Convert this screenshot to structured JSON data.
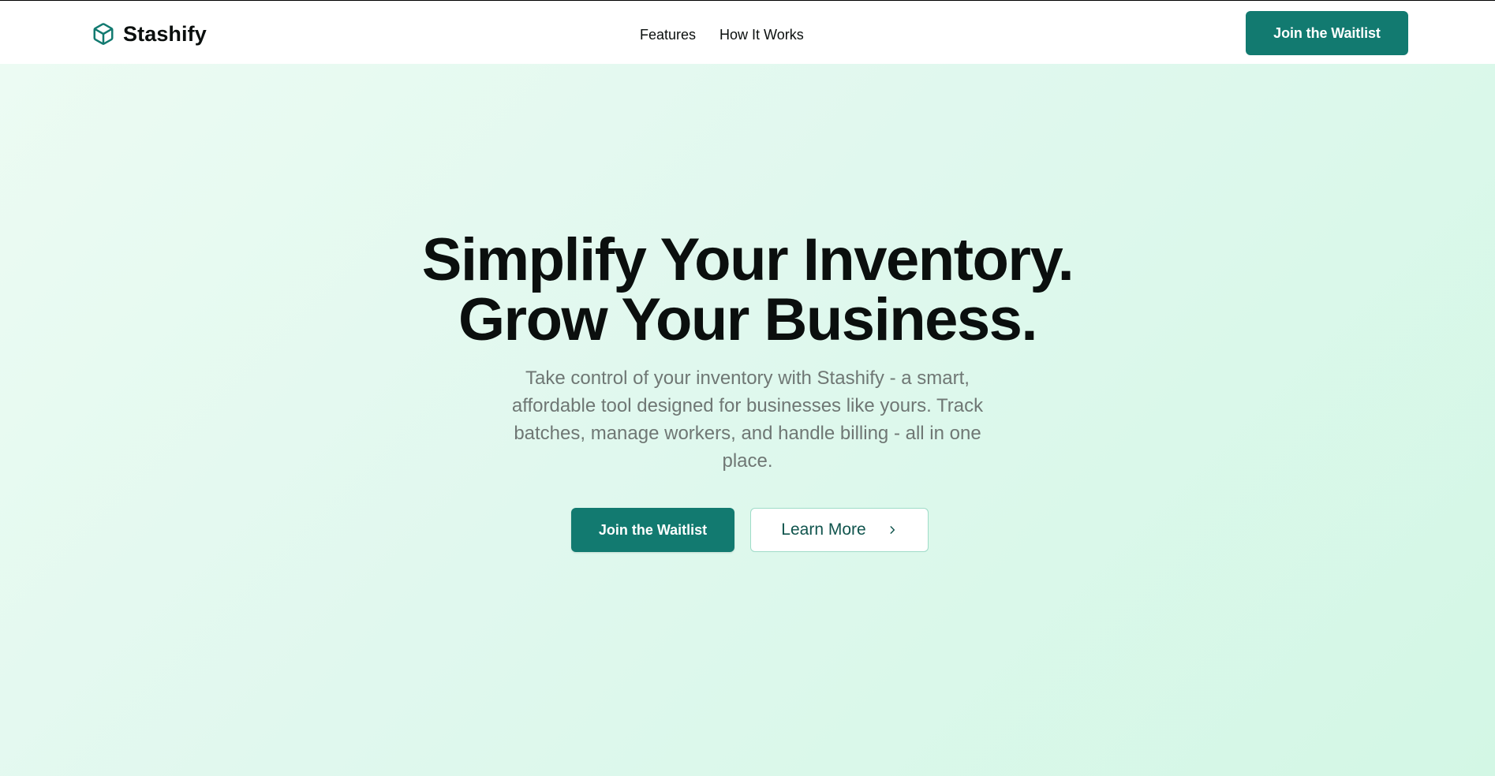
{
  "header": {
    "brand_name": "Stashify",
    "brand_icon": "cube-icon",
    "nav": [
      {
        "label": "Features"
      },
      {
        "label": "How It Works"
      }
    ],
    "cta_label": "Join the Waitlist"
  },
  "hero": {
    "title_line1": "Simplify Your Inventory.",
    "title_line2": "Grow Your Business.",
    "subtitle": "Take control of your inventory with Stashify - a smart, affordable tool designed for businesses like yours. Track batches, manage workers, and handle billing - all in one place.",
    "primary_button_label": "Join the Waitlist",
    "secondary_button_label": "Learn More",
    "secondary_button_icon": "chevron-right-icon"
  },
  "colors": {
    "brand": "#127a70",
    "text_dark": "#0b0f0e",
    "text_muted": "#6f7774",
    "hero_bg_start": "#ecfbf3",
    "hero_bg_end": "#d3f7e5",
    "secondary_border": "#9fdcc8"
  }
}
